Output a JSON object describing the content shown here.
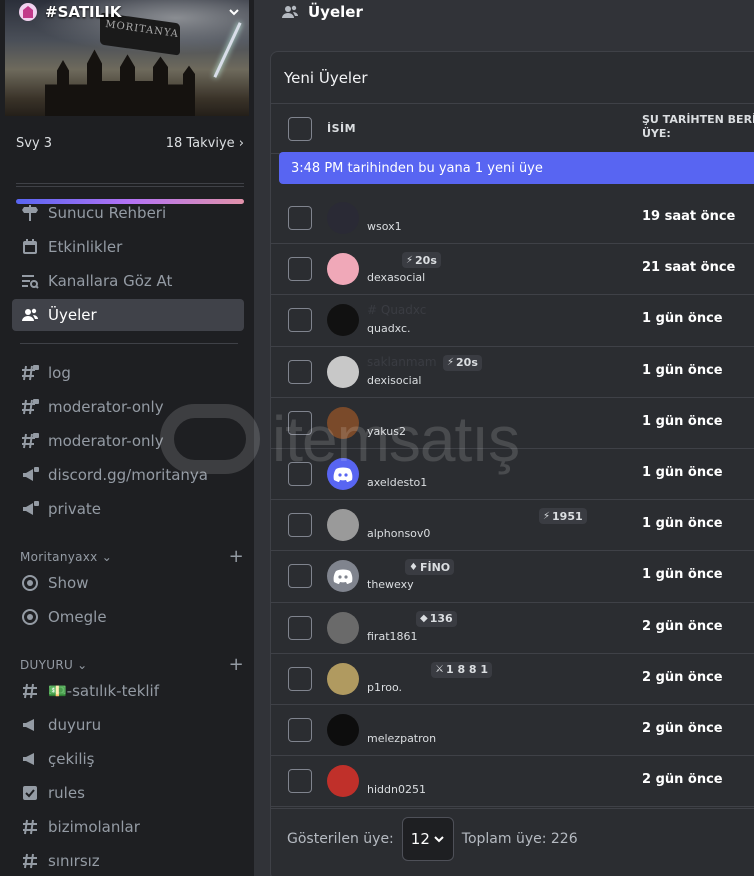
{
  "server": {
    "name": "#SATILIK",
    "banner_text": "MORITANYA",
    "boost_level": "Svy 3",
    "boost_count": "18 Takviye"
  },
  "nav": [
    {
      "label": "Sunucu Rehberi",
      "icon": "signpost-icon"
    },
    {
      "label": "Etkinlikler",
      "icon": "calendar-icon"
    },
    {
      "label": "Kanallara Göz At",
      "icon": "browse-channels-icon"
    },
    {
      "label": "Üyeler",
      "icon": "members-icon",
      "active": true
    }
  ],
  "channels": [
    {
      "label": "log",
      "icon": "hash-lock-icon"
    },
    {
      "label": "moderator-only",
      "icon": "hash-lock-icon"
    },
    {
      "label": "moderator-only",
      "icon": "hash-lock-icon"
    },
    {
      "label": "discord.gg/moritanya",
      "icon": "announcement-lock-icon"
    },
    {
      "label": "private",
      "icon": "announcement-lock-icon"
    }
  ],
  "categories": [
    {
      "label": "Moritanyaxx",
      "items": [
        {
          "label": "Show",
          "icon": "stage-icon"
        },
        {
          "label": "Omegle",
          "icon": "stage-icon"
        }
      ]
    },
    {
      "label": "DUYURU",
      "items": [
        {
          "label": "💵-satılık-teklif",
          "icon": "hash-icon"
        },
        {
          "label": "duyuru",
          "icon": "announcement-icon"
        },
        {
          "label": "çekiliş",
          "icon": "announcement-icon"
        },
        {
          "label": "rules",
          "icon": "rules-icon"
        },
        {
          "label": "bizimolanlar",
          "icon": "hash-icon"
        },
        {
          "label": "sınırsız",
          "icon": "hash-icon"
        }
      ]
    }
  ],
  "main": {
    "title": "Üyeler",
    "panel_title": "Yeni Üyeler",
    "col_name": "İSİM",
    "col_since": "ŞU TARİHTEN BERİ ÜYE:",
    "new_banner": "3:48 PM tarihinden bu yana 1 yeni üye",
    "footer_label": "Gösterilen üye:",
    "page_size": "12",
    "total": "Toplam üye: 226"
  },
  "members": [
    {
      "display": "",
      "username": "wsox1",
      "since": "19 saat önce",
      "avatar": "#2a2a35"
    },
    {
      "display": "",
      "username": "dexasocial",
      "since": "21 saat önce",
      "avatar": "#f0a8b8",
      "badge": "20s",
      "badge_icon": "⚡"
    },
    {
      "display": "# Quadxc",
      "username": "quadxc.",
      "since": "1 gün önce",
      "avatar": "#111111"
    },
    {
      "display": "saklanmam",
      "username": "dexisocial",
      "since": "1 gün önce",
      "avatar": "#c8c8c8",
      "badge": "20s",
      "badge_icon": "⚡"
    },
    {
      "display": "",
      "username": "yakus2",
      "since": "1 gün önce",
      "avatar": "#7a4a2a"
    },
    {
      "display": "",
      "username": "axeldesto1",
      "since": "1 gün önce",
      "avatar": "#5865f2",
      "discord": true
    },
    {
      "display": "",
      "username": "alphonsov0",
      "since": "1 gün önce",
      "avatar": "#9a9a9a",
      "badge": "1951",
      "badge_icon": "⚡"
    },
    {
      "display": "",
      "username": "thewexy",
      "since": "1 gün önce",
      "avatar": "#80848e",
      "badge": "FİNO",
      "badge_icon": "♦",
      "discord": true
    },
    {
      "display": "",
      "username": "firat1861",
      "since": "2 gün önce",
      "avatar": "#6a6a6a",
      "badge": "136",
      "badge_icon": "◆"
    },
    {
      "display": "",
      "username": "p1roo.",
      "since": "2 gün önce",
      "avatar": "#b09a60",
      "badge": "1 8 8 1",
      "badge_icon": "⚔"
    },
    {
      "display": "",
      "username": "melezpatron",
      "since": "2 gün önce",
      "avatar": "#0d0d0d"
    },
    {
      "display": "",
      "username": "hiddn0251",
      "since": "2 gün önce",
      "avatar": "#c0302a"
    }
  ]
}
